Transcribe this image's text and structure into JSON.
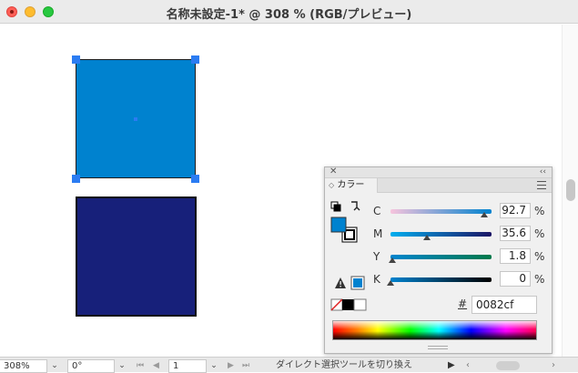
{
  "window": {
    "title": "名称未設定-1* @ 308 % (RGB/プレビュー)"
  },
  "artboard": {
    "shape1_color": "#0082cf",
    "shape2_color": "#17207a",
    "selection_color": "#2b7cf2"
  },
  "color_panel": {
    "tab_label": "カラー",
    "fill_color": "#0082cf",
    "channels": [
      {
        "label": "C",
        "value": "92.7",
        "unit": "%",
        "fraction": 0.927,
        "gradient": [
          "#f7c4dd",
          "#0082cf"
        ]
      },
      {
        "label": "M",
        "value": "35.6",
        "unit": "%",
        "fraction": 0.356,
        "gradient": [
          "#00aeef",
          "#1b1464"
        ]
      },
      {
        "label": "Y",
        "value": "1.8",
        "unit": "%",
        "fraction": 0.018,
        "gradient": [
          "#0085cf",
          "#00794a"
        ]
      },
      {
        "label": "K",
        "value": "0",
        "unit": "%",
        "fraction": 0.0,
        "gradient": [
          "#0082cf",
          "#000000"
        ]
      }
    ],
    "hex_symbol": "#",
    "hex_value": "0082cf"
  },
  "status_bar": {
    "zoom": "308%",
    "rotation": "0°",
    "artboard_number": "1",
    "status_text": "ダイレクト選択ツールを切り換え"
  },
  "icons": {
    "panel_close": "close-icon",
    "panel_collapse": "double-chevron-icon",
    "panel_menu": "hamburger-menu-icon",
    "swap": "swap-arrow-icon",
    "default_colors": "default-colors-icon",
    "warning": "gamut-warning-icon"
  }
}
